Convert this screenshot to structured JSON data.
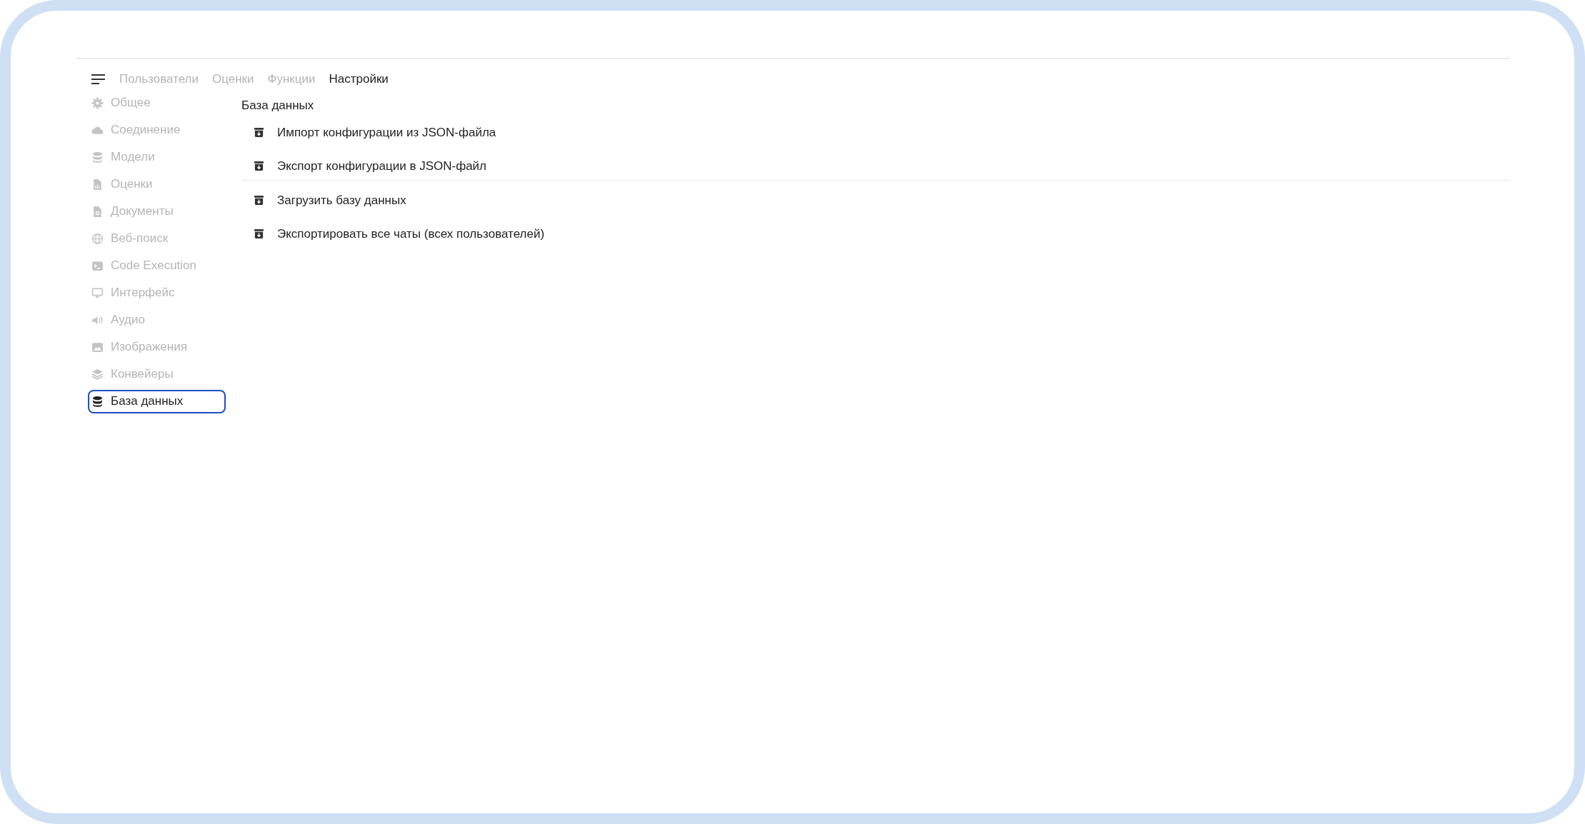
{
  "nav_tabs": [
    {
      "label": "Пользователи",
      "selected": false
    },
    {
      "label": "Оценки",
      "selected": false
    },
    {
      "label": "Функции",
      "selected": false
    },
    {
      "label": "Настройки",
      "selected": true
    }
  ],
  "sidebar": {
    "items": [
      {
        "label": "Общее",
        "selected": false
      },
      {
        "label": "Соединение",
        "selected": false
      },
      {
        "label": "Модели",
        "selected": false
      },
      {
        "label": "Оценки",
        "selected": false
      },
      {
        "label": "Документы",
        "selected": false
      },
      {
        "label": "Веб-поиск",
        "selected": false
      },
      {
        "label": "Code Execution",
        "selected": false
      },
      {
        "label": "Интерфейс",
        "selected": false
      },
      {
        "label": "Аудио",
        "selected": false
      },
      {
        "label": "Изображения",
        "selected": false
      },
      {
        "label": "Конвейеры",
        "selected": false
      },
      {
        "label": "База данных",
        "selected": true
      }
    ]
  },
  "content": {
    "title": "База данных",
    "groups": [
      [
        "Импорт конфигурации из JSON-файла",
        "Экспорт конфигурации в JSON-файл"
      ],
      [
        "Загрузить базу данных",
        "Экспортировать все чаты (всех пользователей)"
      ]
    ]
  }
}
